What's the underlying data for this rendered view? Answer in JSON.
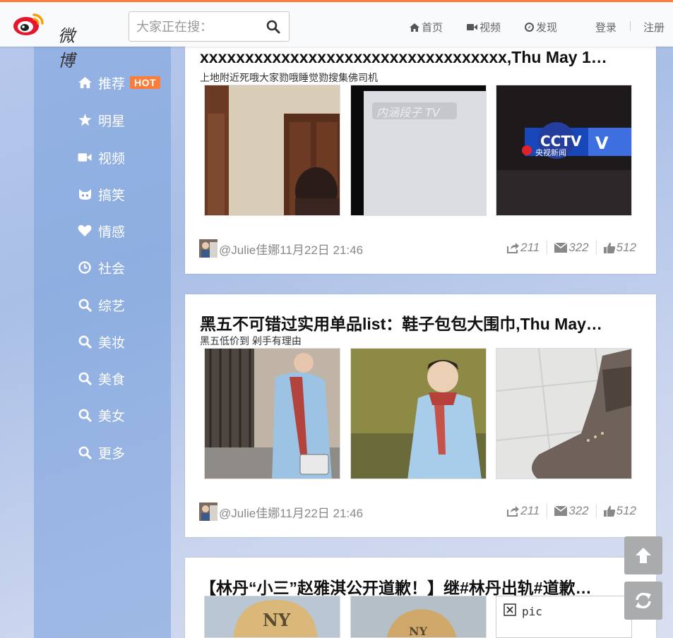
{
  "brand": {
    "name": "微博"
  },
  "search": {
    "placeholder": "大家正在搜："
  },
  "nav": {
    "home": "首页",
    "video": "视频",
    "discover": "发现",
    "login": "登录",
    "register": "注册"
  },
  "sidebar": {
    "hot_badge": "HOT",
    "items": [
      {
        "label": "推荐",
        "icon": "home-icon"
      },
      {
        "label": "明星",
        "icon": "star-icon"
      },
      {
        "label": "视频",
        "icon": "video-camera-icon"
      },
      {
        "label": "搞笑",
        "icon": "cat-face-icon"
      },
      {
        "label": "情感",
        "icon": "heart-icon"
      },
      {
        "label": "社会",
        "icon": "clock-icon"
      },
      {
        "label": "综艺",
        "icon": "search-icon"
      },
      {
        "label": "美妆",
        "icon": "search-icon"
      },
      {
        "label": "美食",
        "icon": "search-icon"
      },
      {
        "label": "美女",
        "icon": "search-icon"
      },
      {
        "label": "更多",
        "icon": "search-icon"
      }
    ]
  },
  "posts": [
    {
      "title": "xxxxxxxxxxxxxxxxxxxxxxxxxxxxxxxxxx,Thu May 1…",
      "subtitle": "上地附近死哦大家勠哦睡觉勠搜集佛司机",
      "author": "@Julie佳娜",
      "time": "11月22日 21:46",
      "reposts": "211",
      "comments": "322",
      "likes": "512"
    },
    {
      "title": "黑五不可错过实用单品list：鞋子包包大围巾,Thu May…",
      "subtitle": "黑五低价到 剁手有理由",
      "author": "@Julie佳娜",
      "time": "11月22日 21:46",
      "reposts": "211",
      "comments": "322",
      "likes": "512"
    },
    {
      "title": "【林丹“小三”赵雅淇公开道歉！】继#林丹出轨#道歉…",
      "broken_image_alt": "pic"
    }
  ],
  "colors": {
    "accent": "#fa7d3c",
    "sidebar": "#7aa0dc",
    "fab": "#a9abad"
  }
}
